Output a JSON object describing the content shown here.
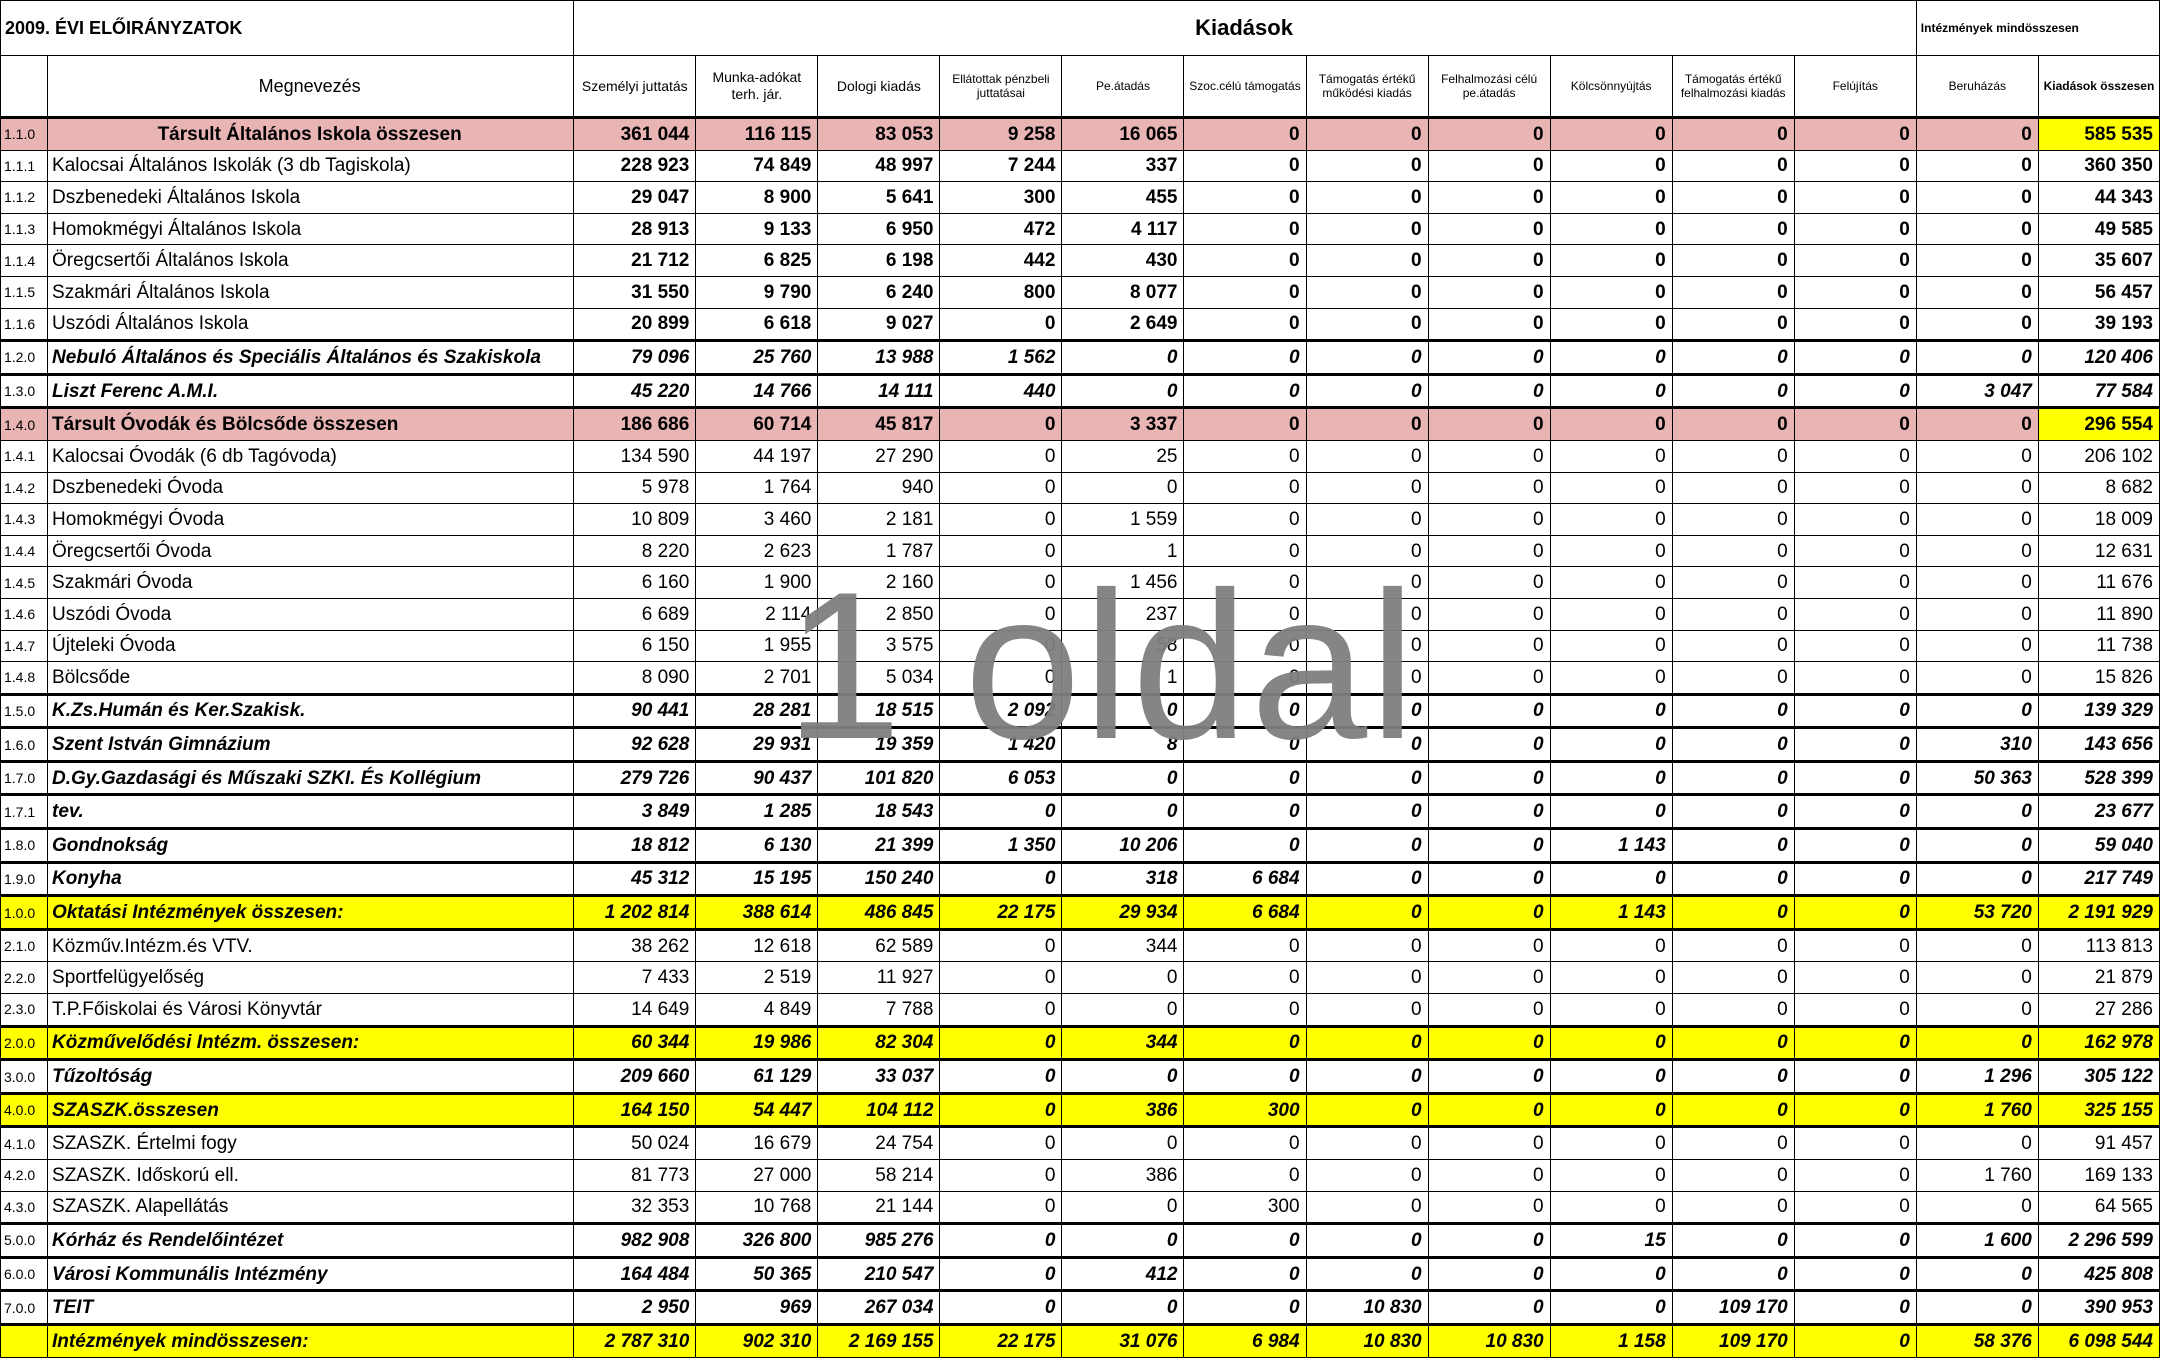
{
  "header": {
    "title": "2009. ÉVI ELŐIRÁNYZATOK",
    "group_label": "Kiadások",
    "total_label": "Intézmények mindösszesen",
    "name_col": "Megnevezés",
    "columns": [
      "Személyi juttatás",
      "Munka-adókat terh. jár.",
      "Dologi kiadás",
      "Ellátottak pénzbeli juttatásai",
      "Pe.átadás",
      "Szoc.célú támogatás",
      "Támogatás értékű működési kiadás",
      "Felhalmozási célú pe.átadás",
      "Kölcsönnyújtás",
      "Támogatás értékű felhalmozási kiadás",
      "Felújítás",
      "Beruházás",
      "Kiadások összesen"
    ]
  },
  "rows": [
    {
      "code": "1.1.0",
      "name": "Társult Általános Iskola összesen",
      "v": [
        "361 044",
        "116 115",
        "83 053",
        "9 258",
        "16 065",
        "0",
        "0",
        "0",
        "0",
        "0",
        "0",
        "0",
        "585 535"
      ]
    },
    {
      "code": "1.1.1",
      "name": "Kalocsai Általános Iskolák (3 db Tagiskola)",
      "v": [
        "228 923",
        "74 849",
        "48 997",
        "7 244",
        "337",
        "0",
        "0",
        "0",
        "0",
        "0",
        "0",
        "0",
        "360 350"
      ]
    },
    {
      "code": "1.1.2",
      "name": "Dszbenedeki Általános Iskola",
      "v": [
        "29 047",
        "8 900",
        "5 641",
        "300",
        "455",
        "0",
        "0",
        "0",
        "0",
        "0",
        "0",
        "0",
        "44 343"
      ]
    },
    {
      "code": "1.1.3",
      "name": "Homokmégyi Általános Iskola",
      "v": [
        "28 913",
        "9 133",
        "6 950",
        "472",
        "4 117",
        "0",
        "0",
        "0",
        "0",
        "0",
        "0",
        "0",
        "49 585"
      ]
    },
    {
      "code": "1.1.4",
      "name": "Öregcsertői Általános Iskola",
      "v": [
        "21 712",
        "6 825",
        "6 198",
        "442",
        "430",
        "0",
        "0",
        "0",
        "0",
        "0",
        "0",
        "0",
        "35 607"
      ]
    },
    {
      "code": "1.1.5",
      "name": "Szakmári Általános Iskola",
      "v": [
        "31 550",
        "9 790",
        "6 240",
        "800",
        "8 077",
        "0",
        "0",
        "0",
        "0",
        "0",
        "0",
        "0",
        "56 457"
      ]
    },
    {
      "code": "1.1.6",
      "name": "Uszódi Általános Iskola",
      "v": [
        "20 899",
        "6 618",
        "9 027",
        "0",
        "2 649",
        "0",
        "0",
        "0",
        "0",
        "0",
        "0",
        "0",
        "39 193"
      ]
    },
    {
      "code": "1.2.0",
      "name": "Nebuló Általános és Speciális Általános és Szakiskola",
      "v": [
        "79 096",
        "25 760",
        "13 988",
        "1 562",
        "0",
        "0",
        "0",
        "0",
        "0",
        "0",
        "0",
        "0",
        "120 406"
      ]
    },
    {
      "code": "1.3.0",
      "name": "Liszt Ferenc A.M.I.",
      "v": [
        "45 220",
        "14 766",
        "14 111",
        "440",
        "0",
        "0",
        "0",
        "0",
        "0",
        "0",
        "0",
        "3 047",
        "77 584"
      ]
    },
    {
      "code": "1.4.0",
      "name": "Társult Óvodák és Bölcsőde összesen",
      "v": [
        "186 686",
        "60 714",
        "45 817",
        "0",
        "3 337",
        "0",
        "0",
        "0",
        "0",
        "0",
        "0",
        "0",
        "296 554"
      ]
    },
    {
      "code": "1.4.1",
      "name": "Kalocsai Óvodák (6 db Tagóvoda)",
      "v": [
        "134 590",
        "44 197",
        "27 290",
        "0",
        "25",
        "0",
        "0",
        "0",
        "0",
        "0",
        "0",
        "0",
        "206 102"
      ]
    },
    {
      "code": "1.4.2",
      "name": "Dszbenedeki Óvoda",
      "v": [
        "5 978",
        "1 764",
        "940",
        "0",
        "0",
        "0",
        "0",
        "0",
        "0",
        "0",
        "0",
        "0",
        "8 682"
      ]
    },
    {
      "code": "1.4.3",
      "name": "Homokmégyi Óvoda",
      "v": [
        "10 809",
        "3 460",
        "2 181",
        "0",
        "1 559",
        "0",
        "0",
        "0",
        "0",
        "0",
        "0",
        "0",
        "18 009"
      ]
    },
    {
      "code": "1.4.4",
      "name": "Öregcsertői Óvoda",
      "v": [
        "8 220",
        "2 623",
        "1 787",
        "0",
        "1",
        "0",
        "0",
        "0",
        "0",
        "0",
        "0",
        "0",
        "12 631"
      ]
    },
    {
      "code": "1.4.5",
      "name": "Szakmári Óvoda",
      "v": [
        "6 160",
        "1 900",
        "2 160",
        "0",
        "1 456",
        "0",
        "0",
        "0",
        "0",
        "0",
        "0",
        "0",
        "11 676"
      ]
    },
    {
      "code": "1.4.6",
      "name": "Uszódi Óvoda",
      "v": [
        "6 689",
        "2 114",
        "2 850",
        "0",
        "237",
        "0",
        "0",
        "0",
        "0",
        "0",
        "0",
        "0",
        "11 890"
      ]
    },
    {
      "code": "1.4.7",
      "name": "Újteleki Óvoda",
      "v": [
        "6 150",
        "1 955",
        "3 575",
        "0",
        "58",
        "0",
        "0",
        "0",
        "0",
        "0",
        "0",
        "0",
        "11 738"
      ]
    },
    {
      "code": "1.4.8",
      "name": "Bölcsőde",
      "v": [
        "8 090",
        "2 701",
        "5 034",
        "0",
        "1",
        "0",
        "0",
        "0",
        "0",
        "0",
        "0",
        "0",
        "15 826"
      ]
    },
    {
      "code": "1.5.0",
      "name": "K.Zs.Humán és Ker.Szakisk.",
      "v": [
        "90 441",
        "28 281",
        "18 515",
        "2 092",
        "0",
        "0",
        "0",
        "0",
        "0",
        "0",
        "0",
        "0",
        "139 329"
      ]
    },
    {
      "code": "1.6.0",
      "name": "Szent István Gimnázium",
      "v": [
        "92 628",
        "29 931",
        "19 359",
        "1 420",
        "8",
        "0",
        "0",
        "0",
        "0",
        "0",
        "0",
        "310",
        "143 656"
      ]
    },
    {
      "code": "1.7.0",
      "name": "D.Gy.Gazdasági és Műszaki SZKI. És Kollégium",
      "v": [
        "279 726",
        "90 437",
        "101 820",
        "6 053",
        "0",
        "0",
        "0",
        "0",
        "0",
        "0",
        "0",
        "50 363",
        "528 399"
      ]
    },
    {
      "code": "1.7.1",
      "name": "tev.",
      "v": [
        "3 849",
        "1 285",
        "18 543",
        "0",
        "0",
        "0",
        "0",
        "0",
        "0",
        "0",
        "0",
        "0",
        "23 677"
      ]
    },
    {
      "code": "1.8.0",
      "name": "Gondnokság",
      "v": [
        "18 812",
        "6 130",
        "21 399",
        "1 350",
        "10 206",
        "0",
        "0",
        "0",
        "1 143",
        "0",
        "0",
        "0",
        "59 040"
      ]
    },
    {
      "code": "1.9.0",
      "name": "Konyha",
      "v": [
        "45 312",
        "15 195",
        "150 240",
        "0",
        "318",
        "6 684",
        "0",
        "0",
        "0",
        "0",
        "0",
        "0",
        "217 749"
      ]
    },
    {
      "code": "1.0.0",
      "name": "Oktatási Intézmények összesen:",
      "v": [
        "1 202 814",
        "388 614",
        "486 845",
        "22 175",
        "29 934",
        "6 684",
        "0",
        "0",
        "1 143",
        "0",
        "0",
        "53 720",
        "2 191 929"
      ]
    },
    {
      "code": "2.1.0",
      "name": "Közműv.Intézm.és VTV.",
      "v": [
        "38 262",
        "12 618",
        "62 589",
        "0",
        "344",
        "0",
        "0",
        "0",
        "0",
        "0",
        "0",
        "0",
        "113 813"
      ]
    },
    {
      "code": "2.2.0",
      "name": "Sportfelügyelőség",
      "v": [
        "7 433",
        "2 519",
        "11 927",
        "0",
        "0",
        "0",
        "0",
        "0",
        "0",
        "0",
        "0",
        "0",
        "21 879"
      ]
    },
    {
      "code": "2.3.0",
      "name": "T.P.Főiskolai és Városi Könyvtár",
      "v": [
        "14 649",
        "4 849",
        "7 788",
        "0",
        "0",
        "0",
        "0",
        "0",
        "0",
        "0",
        "0",
        "0",
        "27 286"
      ]
    },
    {
      "code": "2.0.0",
      "name": "Közművelődési Intézm. összesen:",
      "v": [
        "60 344",
        "19 986",
        "82 304",
        "0",
        "344",
        "0",
        "0",
        "0",
        "0",
        "0",
        "0",
        "0",
        "162 978"
      ]
    },
    {
      "code": "3.0.0",
      "name": "Tűzoltóság",
      "v": [
        "209 660",
        "61 129",
        "33 037",
        "0",
        "0",
        "0",
        "0",
        "0",
        "0",
        "0",
        "0",
        "1 296",
        "305 122"
      ]
    },
    {
      "code": "4.0.0",
      "name": "SZASZK.összesen",
      "v": [
        "164 150",
        "54 447",
        "104 112",
        "0",
        "386",
        "300",
        "0",
        "0",
        "0",
        "0",
        "0",
        "1 760",
        "325 155"
      ]
    },
    {
      "code": "4.1.0",
      "name": "SZASZK. Értelmi fogy",
      "v": [
        "50 024",
        "16 679",
        "24 754",
        "0",
        "0",
        "0",
        "0",
        "0",
        "0",
        "0",
        "0",
        "0",
        "91 457"
      ]
    },
    {
      "code": "4.2.0",
      "name": "SZASZK. Időskorú ell.",
      "v": [
        "81 773",
        "27 000",
        "58 214",
        "0",
        "386",
        "0",
        "0",
        "0",
        "0",
        "0",
        "0",
        "1 760",
        "169 133"
      ]
    },
    {
      "code": "4.3.0",
      "name": "SZASZK. Alapellátás",
      "v": [
        "32 353",
        "10 768",
        "21 144",
        "0",
        "0",
        "300",
        "0",
        "0",
        "0",
        "0",
        "0",
        "0",
        "64 565"
      ]
    },
    {
      "code": "5.0.0",
      "name": "Kórház és Rendelőintézet",
      "v": [
        "982 908",
        "326 800",
        "985 276",
        "0",
        "0",
        "0",
        "0",
        "0",
        "15",
        "0",
        "0",
        "1 600",
        "2 296 599"
      ]
    },
    {
      "code": "6.0.0",
      "name": "Városi Kommunális Intézmény",
      "v": [
        "164 484",
        "50 365",
        "210 547",
        "0",
        "412",
        "0",
        "0",
        "0",
        "0",
        "0",
        "0",
        "0",
        "425 808"
      ]
    },
    {
      "code": "7.0.0",
      "name": "TEIT",
      "v": [
        "2 950",
        "969",
        "267 034",
        "0",
        "0",
        "0",
        "10 830",
        "0",
        "0",
        "109 170",
        "0",
        "0",
        "390 953"
      ]
    },
    {
      "code": "",
      "name": "Intézmények mindösszesen:",
      "v": [
        "2 787 310",
        "902 310",
        "2 169 155",
        "22 175",
        "31 076",
        "6 984",
        "10 830",
        "10 830",
        "1 158",
        "109 170",
        "0",
        "58 376",
        "6 098 544"
      ]
    }
  ],
  "watermark": "1 oldal",
  "colors": {
    "pink": "#e8b4b4",
    "yellow": "#ffff00",
    "watermark": "#7f7f7f"
  }
}
